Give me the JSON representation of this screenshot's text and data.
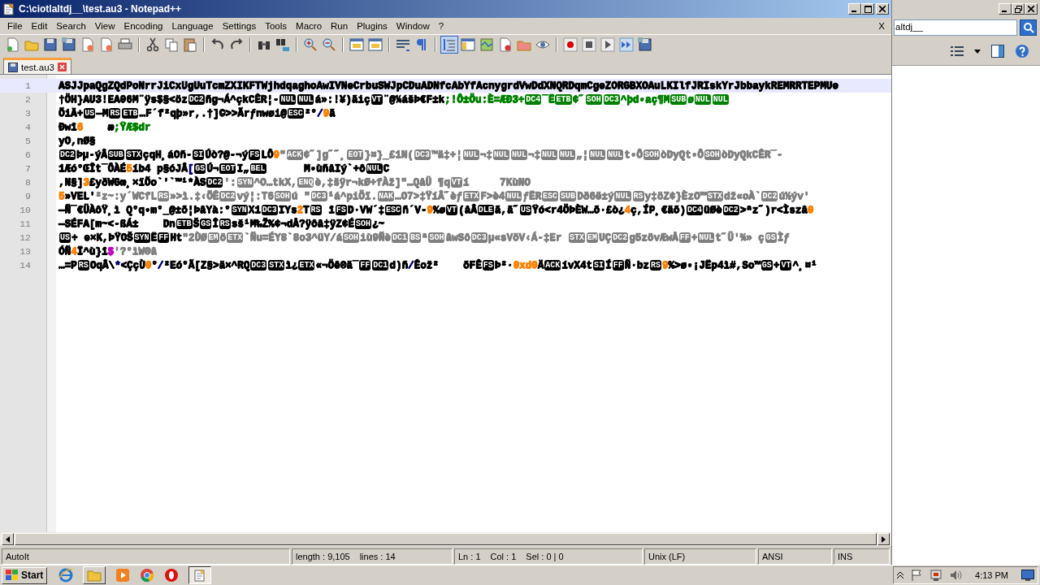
{
  "window": {
    "title": "C:\\ciotlaltdj__\\test.au3 - Notepad++"
  },
  "menu": [
    "File",
    "Edit",
    "Search",
    "View",
    "Encoding",
    "Language",
    "Settings",
    "Tools",
    "Macro",
    "Run",
    "Plugins",
    "Window",
    "?"
  ],
  "menu_close": "X",
  "tabs": [
    {
      "label": "test.au3",
      "selected": true
    }
  ],
  "editor": {
    "lines": [
      {
        "number": "1",
        "current": true,
        "segments": [
          {
            "kind": "text",
            "color": "#000000",
            "text": "ASJJpaQgZQdPoNrrJiCxUgUuTcmZXIKFTWjhdqaghoAwIVNeCrbuSWJpCDuADNfcAbYfAcnygrdVwDdXNQRDqmCgeZORGBXOAuLKIlfJRIskYrJbbaykREMRRTEPMUe"
          }
        ]
      },
      {
        "number": "2",
        "current": false,
        "segments": [
          {
            "kind": "text",
            "color": "#000000",
            "text": "†ÖH}AU3!EA06M¨ÿs$§<öz"
          },
          {
            "kind": "ctrl",
            "color": "#000000",
            "text": "DC2"
          },
          {
            "kind": "text",
            "color": "#000000",
            "text": "ñg¬Á^çkCÊR¦-"
          },
          {
            "kind": "ctrl",
            "color": "#000000",
            "text": "NUL"
          },
          {
            "kind": "ctrl",
            "color": "#000000",
            "text": "NUL"
          },
          {
            "kind": "text",
            "color": "#000000",
            "text": "á»:!¥)ãiç"
          },
          {
            "kind": "ctrl",
            "color": "#000000",
            "text": "VT"
          },
          {
            "kind": "text",
            "color": "#000000",
            "text": "¨@¼ášÞ€F±k"
          },
          {
            "kind": "text",
            "color": "#008000",
            "text": ";!Ô±Öu:È=ÆÐ3÷"
          },
          {
            "kind": "ctrl",
            "color": "#008000",
            "text": "DC4"
          },
          {
            "kind": "text",
            "color": "#008000",
            "text": "¯Ë"
          },
          {
            "kind": "ctrl",
            "color": "#008000",
            "text": "ETB"
          },
          {
            "kind": "text",
            "color": "#008000",
            "text": "¢˝"
          },
          {
            "kind": "ctrl",
            "color": "#008000",
            "text": "SOH"
          },
          {
            "kind": "ctrl",
            "color": "#008000",
            "text": "DC3"
          },
          {
            "kind": "text",
            "color": "#008000",
            "text": "^þd•aç¶M"
          },
          {
            "kind": "ctrl",
            "color": "#008000",
            "text": "SUB"
          },
          {
            "kind": "text",
            "color": "#008000",
            "text": "ø"
          },
          {
            "kind": "ctrl",
            "color": "#008000",
            "text": "NUL"
          },
          {
            "kind": "ctrl",
            "color": "#008000",
            "text": "NUL"
          }
        ]
      },
      {
        "number": "3",
        "current": false,
        "segments": [
          {
            "kind": "text",
            "color": "#000000",
            "text": "ÕiÄ+"
          },
          {
            "kind": "ctrl",
            "color": "#000000",
            "text": "US"
          },
          {
            "kind": "text",
            "color": "#000000",
            "text": "—M"
          },
          {
            "kind": "ctrl",
            "color": "#000000",
            "text": "RS"
          },
          {
            "kind": "ctrl",
            "color": "#000000",
            "text": "ETB"
          },
          {
            "kind": "text",
            "color": "#000000",
            "text": "…F´f²qþ»r,.†]©>>Ãrƒnwøi@"
          },
          {
            "kind": "ctrl",
            "color": "#000000",
            "text": "ESC"
          },
          {
            "kind": "text",
            "color": "#000000",
            "text": "²°"
          },
          {
            "kind": "text",
            "color": "#000080",
            "text": "/"
          },
          {
            "kind": "text",
            "color": "#ff8000",
            "text": "9"
          },
          {
            "kind": "text",
            "color": "#000000",
            "text": "ã"
          }
        ]
      },
      {
        "number": "4",
        "current": false,
        "segments": [
          {
            "kind": "text",
            "color": "#000000",
            "text": "Ðwî"
          },
          {
            "kind": "text",
            "color": "#ff8000",
            "text": "6"
          },
          {
            "kind": "text",
            "color": "#000000",
            "text": "    æ"
          },
          {
            "kind": "text",
            "color": "#008000",
            "text": ";ŸÆ$dr"
          }
        ]
      },
      {
        "number": "5",
        "current": false,
        "segments": [
          {
            "kind": "text",
            "color": "#000000",
            "text": "yO,nØ§"
          }
        ]
      },
      {
        "number": "6",
        "current": false,
        "segments": [
          {
            "kind": "ctrl",
            "color": "#000000",
            "text": "DC2"
          },
          {
            "kind": "text",
            "color": "#000000",
            "text": "Þµ-ýÂ"
          },
          {
            "kind": "ctrl",
            "color": "#000000",
            "text": "SUB"
          },
          {
            "kind": "ctrl",
            "color": "#000000",
            "text": "STX"
          },
          {
            "kind": "text",
            "color": "#000000",
            "text": "çqH¸áOñ-"
          },
          {
            "kind": "ctrl",
            "color": "#000000",
            "text": "SI"
          },
          {
            "kind": "text",
            "color": "#000000",
            "text": "Úò?@-¬ý"
          },
          {
            "kind": "ctrl",
            "color": "#000000",
            "text": "FS"
          },
          {
            "kind": "text",
            "color": "#000000",
            "text": "LÔ"
          },
          {
            "kind": "text",
            "color": "#ff8000",
            "text": "9"
          },
          {
            "kind": "text",
            "color": "#808080",
            "text": "\""
          },
          {
            "kind": "ctrl",
            "color": "#808080",
            "text": "ACK"
          },
          {
            "kind": "text",
            "color": "#808080",
            "text": "¢˝]g˝˝¸"
          },
          {
            "kind": "ctrl",
            "color": "#808080",
            "text": "EOT"
          },
          {
            "kind": "text",
            "color": "#808080",
            "text": "}¤}_£1N("
          },
          {
            "kind": "ctrl",
            "color": "#808080",
            "text": "DC3"
          },
          {
            "kind": "text",
            "color": "#808080",
            "text": "™ä‡+¦"
          },
          {
            "kind": "ctrl",
            "color": "#808080",
            "text": "NUL"
          },
          {
            "kind": "text",
            "color": "#808080",
            "text": "¬‡"
          },
          {
            "kind": "ctrl",
            "color": "#808080",
            "text": "NUL"
          },
          {
            "kind": "ctrl",
            "color": "#808080",
            "text": "NUL"
          },
          {
            "kind": "text",
            "color": "#808080",
            "text": "¬‡"
          },
          {
            "kind": "ctrl",
            "color": "#808080",
            "text": "NUL"
          },
          {
            "kind": "ctrl",
            "color": "#808080",
            "text": "NUL"
          },
          {
            "kind": "text",
            "color": "#808080",
            "text": "„¦"
          },
          {
            "kind": "ctrl",
            "color": "#808080",
            "text": "NUL"
          },
          {
            "kind": "ctrl",
            "color": "#808080",
            "text": "NUL"
          },
          {
            "kind": "text",
            "color": "#808080",
            "text": "t•Ô"
          },
          {
            "kind": "ctrl",
            "color": "#808080",
            "text": "SOH"
          },
          {
            "kind": "text",
            "color": "#808080",
            "text": "òDyQt•Ô"
          },
          {
            "kind": "ctrl",
            "color": "#808080",
            "text": "SOH"
          },
          {
            "kind": "text",
            "color": "#808080",
            "text": "òDyQkCÊR¯-"
          }
        ]
      },
      {
        "number": "7",
        "current": false,
        "segments": [
          {
            "kind": "text",
            "color": "#000000",
            "text": "1Æó°ŒÎt¯ÔÀÉ"
          },
          {
            "kind": "text",
            "color": "#ff8000",
            "text": "5"
          },
          {
            "kind": "text",
            "color": "#000000",
            "text": "íb4 p§óJÂ"
          },
          {
            "kind": "text",
            "color": "#000080",
            "text": "["
          },
          {
            "kind": "ctrl",
            "color": "#000000",
            "text": "GS"
          },
          {
            "kind": "text",
            "color": "#000000",
            "text": "Ú¬"
          },
          {
            "kind": "ctrl",
            "color": "#000000",
            "text": "EOT"
          },
          {
            "kind": "text",
            "color": "#000000",
            "text": "I„"
          },
          {
            "kind": "ctrl",
            "color": "#000000",
            "text": "BEL"
          },
          {
            "kind": "text",
            "color": "#000000",
            "text": "      M•ùñåIý`+ô"
          },
          {
            "kind": "ctrl",
            "color": "#000000",
            "text": "NUL"
          },
          {
            "kind": "text",
            "color": "#000000",
            "text": "C"
          }
        ]
      },
      {
        "number": "8",
        "current": false,
        "segments": [
          {
            "kind": "text",
            "color": "#000000",
            "text": ",N§]"
          },
          {
            "kind": "text",
            "color": "#ff8000",
            "text": "3"
          },
          {
            "kind": "text",
            "color": "#000000",
            "text": "£yðWGœ¸×ïÕo`'`™¹*ÀS"
          },
          {
            "kind": "ctrl",
            "color": "#000000",
            "text": "DC2"
          },
          {
            "kind": "text",
            "color": "#808080",
            "text": "':"
          },
          {
            "kind": "ctrl",
            "color": "#808080",
            "text": "SYN"
          },
          {
            "kind": "text",
            "color": "#808080",
            "text": "^O…tkX,"
          },
          {
            "kind": "ctrl",
            "color": "#808080",
            "text": "ENQ"
          },
          {
            "kind": "text",
            "color": "#808080",
            "text": "è,‡šÿr¬kØ+fÀž]\"…QåÜ ¶q"
          },
          {
            "kind": "ctrl",
            "color": "#808080",
            "text": "VT"
          },
          {
            "kind": "text",
            "color": "#808080",
            "text": "í     7KùNO"
          }
        ]
      },
      {
        "number": "9",
        "current": false,
        "segments": [
          {
            "kind": "text",
            "color": "#ff8000",
            "text": "5"
          },
          {
            "kind": "text",
            "color": "#000000",
            "text": "»VEL'"
          },
          {
            "kind": "text",
            "color": "#808080",
            "text": "²z~:y´WCfL"
          },
          {
            "kind": "ctrl",
            "color": "#808080",
            "text": "RS"
          },
          {
            "kind": "text",
            "color": "#808080",
            "text": "»>ì.‡‹ÕÊ"
          },
          {
            "kind": "ctrl",
            "color": "#808080",
            "text": "DC2"
          },
          {
            "kind": "text",
            "color": "#808080",
            "text": "vý¦:T6"
          },
          {
            "kind": "ctrl",
            "color": "#808080",
            "text": "SOH"
          },
          {
            "kind": "text",
            "color": "#808080",
            "text": "ú \""
          },
          {
            "kind": "ctrl",
            "color": "#808080",
            "text": "DC3"
          },
          {
            "kind": "text",
            "color": "#808080",
            "text": "¹á^piÖï."
          },
          {
            "kind": "ctrl",
            "color": "#808080",
            "text": "NAK"
          },
          {
            "kind": "text",
            "color": "#808080",
            "text": "…O7>‡ŸíÂ˝èƒ"
          },
          {
            "kind": "ctrl",
            "color": "#808080",
            "text": "ETX"
          },
          {
            "kind": "text",
            "color": "#808080",
            "text": "F>è4"
          },
          {
            "kind": "ctrl",
            "color": "#808080",
            "text": "NUL"
          },
          {
            "kind": "text",
            "color": "#808080",
            "text": "ƒËR"
          },
          {
            "kind": "ctrl",
            "color": "#808080",
            "text": "ESC"
          },
          {
            "kind": "ctrl",
            "color": "#808080",
            "text": "SUB"
          },
          {
            "kind": "text",
            "color": "#808080",
            "text": "Dð6ë±ý"
          },
          {
            "kind": "ctrl",
            "color": "#808080",
            "text": "NUL"
          },
          {
            "kind": "ctrl",
            "color": "#808080",
            "text": "RS"
          },
          {
            "kind": "text",
            "color": "#808080",
            "text": "y‡öZ¢}ÈzO™"
          },
          {
            "kind": "ctrl",
            "color": "#808080",
            "text": "STX"
          },
          {
            "kind": "text",
            "color": "#808080",
            "text": "dž«oÀ`"
          },
          {
            "kind": "ctrl",
            "color": "#808080",
            "text": "DC2"
          },
          {
            "kind": "text",
            "color": "#808080",
            "text": "ú½ýv'"
          }
        ]
      },
      {
        "number": "10",
        "current": false,
        "segments": [
          {
            "kind": "text",
            "color": "#000000",
            "text": "—Ñ¯€ÜÀôŸ¸ì Q°q•m°_@±õ¦ÞâYà:°"
          },
          {
            "kind": "ctrl",
            "color": "#000000",
            "text": "SYN"
          },
          {
            "kind": "text",
            "color": "#000000",
            "text": "X1"
          },
          {
            "kind": "ctrl",
            "color": "#000000",
            "text": "DC3"
          },
          {
            "kind": "text",
            "color": "#000000",
            "text": "IYs"
          },
          {
            "kind": "text",
            "color": "#ff8000",
            "text": "2"
          },
          {
            "kind": "text",
            "color": "#000000",
            "text": "T"
          },
          {
            "kind": "ctrl",
            "color": "#000000",
            "text": "RS"
          },
          {
            "kind": "text",
            "color": "#000000",
            "text": " î"
          },
          {
            "kind": "ctrl",
            "color": "#000000",
            "text": "FS"
          },
          {
            "kind": "text",
            "color": "#000000",
            "text": "D·VW´‡"
          },
          {
            "kind": "ctrl",
            "color": "#000000",
            "text": "ESC"
          },
          {
            "kind": "text",
            "color": "#000000",
            "text": "ñ´V-"
          },
          {
            "kind": "text",
            "color": "#ff8000",
            "text": "9"
          },
          {
            "kind": "text",
            "color": "#000000",
            "text": "%ø"
          },
          {
            "kind": "ctrl",
            "color": "#000000",
            "text": "VT"
          },
          {
            "kind": "text",
            "color": "#000000",
            "text": "(åÂ"
          },
          {
            "kind": "ctrl",
            "color": "#000000",
            "text": "DLE"
          },
          {
            "kind": "text",
            "color": "#000000",
            "text": "ã,ã˝"
          },
          {
            "kind": "ctrl",
            "color": "#000000",
            "text": "US"
          },
          {
            "kind": "text",
            "color": "#000000",
            "text": "Ÿó<r4ÖÞÈW…õ·£ò¿"
          },
          {
            "kind": "text",
            "color": "#ff8000",
            "text": "4"
          },
          {
            "kind": "text",
            "color": "#000000",
            "text": "ç,ÍP¸€äõ)"
          },
          {
            "kind": "ctrl",
            "color": "#000000",
            "text": "DC4"
          },
          {
            "kind": "text",
            "color": "#000000",
            "text": "üØè"
          },
          {
            "kind": "ctrl",
            "color": "#000000",
            "text": "DC2"
          },
          {
            "kind": "text",
            "color": "#000000",
            "text": ">ªz˝)r<Ìszâ"
          },
          {
            "kind": "text",
            "color": "#ff8000",
            "text": "0"
          }
        ]
      },
      {
        "number": "11",
        "current": false,
        "segments": [
          {
            "kind": "text",
            "color": "#000000",
            "text": "—SÉFA[m~<-ßÁ±    Dn"
          },
          {
            "kind": "ctrl",
            "color": "#000000",
            "text": "ETB"
          },
          {
            "kind": "text",
            "color": "#000000",
            "text": "Š"
          },
          {
            "kind": "ctrl",
            "color": "#000000",
            "text": "GS"
          },
          {
            "kind": "text",
            "color": "#000000",
            "text": "Î"
          },
          {
            "kind": "ctrl",
            "color": "#000000",
            "text": "RS"
          },
          {
            "kind": "text",
            "color": "#000000",
            "text": "sš¹M‰Ž%¢¬dÅ?ÿôâ‡ÿZ¢É"
          },
          {
            "kind": "ctrl",
            "color": "#000000",
            "text": "SOH"
          },
          {
            "kind": "text",
            "color": "#000000",
            "text": "¿~"
          }
        ]
      },
      {
        "number": "12",
        "current": false,
        "segments": [
          {
            "kind": "ctrl",
            "color": "#000000",
            "text": "US"
          },
          {
            "kind": "text",
            "color": "#000000",
            "text": "÷ e×K,ÞŸOŠ"
          },
          {
            "kind": "ctrl",
            "color": "#000000",
            "text": "SYN"
          },
          {
            "kind": "text",
            "color": "#000000",
            "text": "Ë"
          },
          {
            "kind": "ctrl",
            "color": "#000000",
            "text": "FF"
          },
          {
            "kind": "text",
            "color": "#000000",
            "text": "Ht"
          },
          {
            "kind": "text",
            "color": "#808080",
            "text": "\"2ÙØ"
          },
          {
            "kind": "ctrl",
            "color": "#808080",
            "text": "EM"
          },
          {
            "kind": "text",
            "color": "#808080",
            "text": "ö"
          },
          {
            "kind": "ctrl",
            "color": "#808080",
            "text": "ETX"
          },
          {
            "kind": "text",
            "color": "#808080",
            "text": "`Ñu=ÉY8`8o3^üY/á"
          },
          {
            "kind": "ctrl",
            "color": "#808080",
            "text": "SOH"
          },
          {
            "kind": "text",
            "color": "#808080",
            "text": "iù9Ñè"
          },
          {
            "kind": "ctrl",
            "color": "#808080",
            "text": "DC1"
          },
          {
            "kind": "ctrl",
            "color": "#808080",
            "text": "BS"
          },
          {
            "kind": "text",
            "color": "#808080",
            "text": "ª"
          },
          {
            "kind": "ctrl",
            "color": "#808080",
            "text": "SOH"
          },
          {
            "kind": "text",
            "color": "#808080",
            "text": "âwSô"
          },
          {
            "kind": "ctrl",
            "color": "#808080",
            "text": "DC3"
          },
          {
            "kind": "text",
            "color": "#808080",
            "text": "µ«sVöV‹Á-‡Er "
          },
          {
            "kind": "ctrl",
            "color": "#808080",
            "text": "STX"
          },
          {
            "kind": "ctrl",
            "color": "#808080",
            "text": "EM"
          },
          {
            "kind": "text",
            "color": "#808080",
            "text": "UÇ"
          },
          {
            "kind": "ctrl",
            "color": "#808080",
            "text": "DC2"
          },
          {
            "kind": "text",
            "color": "#808080",
            "text": "g5zövÆwÅ"
          },
          {
            "kind": "ctrl",
            "color": "#808080",
            "text": "FF"
          },
          {
            "kind": "text",
            "color": "#808080",
            "text": "+"
          },
          {
            "kind": "ctrl",
            "color": "#808080",
            "text": "NUL"
          },
          {
            "kind": "text",
            "color": "#808080",
            "text": "t˝Ü'¾» ç"
          },
          {
            "kind": "ctrl",
            "color": "#808080",
            "text": "GS"
          },
          {
            "kind": "text",
            "color": "#808080",
            "text": "Ìƒ"
          }
        ]
      },
      {
        "number": "13",
        "current": false,
        "segments": [
          {
            "kind": "text",
            "color": "#000000",
            "text": "ÓÑ"
          },
          {
            "kind": "text",
            "color": "#ff8000",
            "text": "4"
          },
          {
            "kind": "text",
            "color": "#000000",
            "text": "Ï^ù}î"
          },
          {
            "kind": "text",
            "color": "#c000c0",
            "text": "$"
          },
          {
            "kind": "text",
            "color": "#808080",
            "text": "'?°ìW®â"
          }
        ]
      },
      {
        "number": "14",
        "current": false,
        "segments": [
          {
            "kind": "text",
            "color": "#000000",
            "text": "…=P"
          },
          {
            "kind": "ctrl",
            "color": "#000000",
            "text": "RS"
          },
          {
            "kind": "text",
            "color": "#000000",
            "text": "OqÂ\\"
          },
          {
            "kind": "text",
            "color": "#000080",
            "text": "*"
          },
          {
            "kind": "text",
            "color": "#000000",
            "text": "<ÇçÙ"
          },
          {
            "kind": "text",
            "color": "#ff8000",
            "text": "0"
          },
          {
            "kind": "text",
            "color": "#000000",
            "text": "°"
          },
          {
            "kind": "text",
            "color": "#000080",
            "text": "/"
          },
          {
            "kind": "text",
            "color": "#000000",
            "text": "²Eó°Ã[Z§>ä×^RQ"
          },
          {
            "kind": "ctrl",
            "color": "#000000",
            "text": "DC3"
          },
          {
            "kind": "ctrl",
            "color": "#000000",
            "text": "STX"
          },
          {
            "kind": "text",
            "color": "#000000",
            "text": "ì¿"
          },
          {
            "kind": "ctrl",
            "color": "#000000",
            "text": "ETX"
          },
          {
            "kind": "text",
            "color": "#000000",
            "text": "«¬Öê®ä¯"
          },
          {
            "kind": "ctrl",
            "color": "#000000",
            "text": "FF"
          },
          {
            "kind": "ctrl",
            "color": "#000000",
            "text": "DC1"
          },
          {
            "kind": "text",
            "color": "#000000",
            "text": "d)ñ"
          },
          {
            "kind": "text",
            "color": "#000080",
            "text": "/"
          },
          {
            "kind": "text",
            "color": "#000000",
            "text": "Êož²    õFÊ"
          },
          {
            "kind": "ctrl",
            "color": "#000000",
            "text": "FS"
          },
          {
            "kind": "text",
            "color": "#000000",
            "text": "Þ²·"
          },
          {
            "kind": "text",
            "color": "#ff8000",
            "text": "0xd0"
          },
          {
            "kind": "text",
            "color": "#000000",
            "text": "Ä"
          },
          {
            "kind": "ctrl",
            "color": "#000000",
            "text": "ACK"
          },
          {
            "kind": "text",
            "color": "#000000",
            "text": "ívX4t"
          },
          {
            "kind": "ctrl",
            "color": "#000000",
            "text": "SI"
          },
          {
            "kind": "text",
            "color": "#000000",
            "text": "Í"
          },
          {
            "kind": "ctrl",
            "color": "#000000",
            "text": "FF"
          },
          {
            "kind": "text",
            "color": "#000000",
            "text": "Ñ·bz"
          },
          {
            "kind": "ctrl",
            "color": "#000000",
            "text": "RS"
          },
          {
            "kind": "text",
            "color": "#ff8000",
            "text": "9"
          },
          {
            "kind": "text",
            "color": "#000000",
            "text": "%>ø•¡JËp4ì#,So™"
          },
          {
            "kind": "ctrl",
            "color": "#000000",
            "text": "GS"
          },
          {
            "kind": "text",
            "color": "#000000",
            "text": "+"
          },
          {
            "kind": "ctrl",
            "color": "#000000",
            "text": "VT"
          },
          {
            "kind": "text",
            "color": "#000000",
            "text": "^¸¤¹"
          }
        ]
      }
    ]
  },
  "status_bar": [
    [
      "AutoIt"
    ],
    [
      "length : 9,105",
      "lines : 14"
    ],
    [
      "Ln : 1",
      "Col : 1",
      "Sel : 0 | 0"
    ],
    [
      "Unix (LF)"
    ],
    [
      "ANSI"
    ],
    [
      "INS"
    ]
  ],
  "background_window": {
    "search_value": "altdj__"
  },
  "taskbar": {
    "start": "Start",
    "clock": "4:13 PM"
  }
}
